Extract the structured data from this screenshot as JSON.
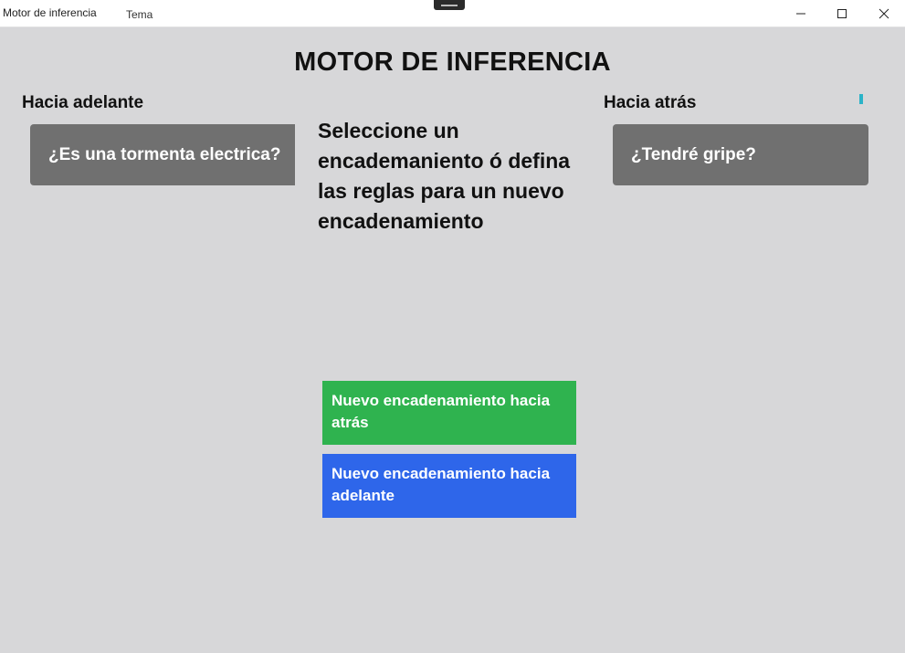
{
  "window": {
    "title": "Motor de inferencia",
    "menu_item": "Tema"
  },
  "main": {
    "title": "MOTOR DE INFERENCIA",
    "forward_label": "Hacia adelante",
    "backward_label": "Hacia atrás",
    "instruction": "Seleccione un encademaniento ó defina las reglas para un nuevo encadenamiento",
    "forward_chains": [
      "¿Es una tormenta electrica?"
    ],
    "backward_chains": [
      "¿Tendré gripe?"
    ]
  },
  "actions": {
    "new_backward": "Nuevo encadenamiento hacia atrás",
    "new_forward": "Nuevo encadenamiento hacia adelante"
  },
  "colors": {
    "card": "#707070",
    "btn_backward": "#2fb34f",
    "btn_forward": "#2e66ea",
    "accent": "#2bb3c8"
  },
  "icons": [
    "minimize-icon",
    "maximize-icon",
    "close-icon"
  ]
}
